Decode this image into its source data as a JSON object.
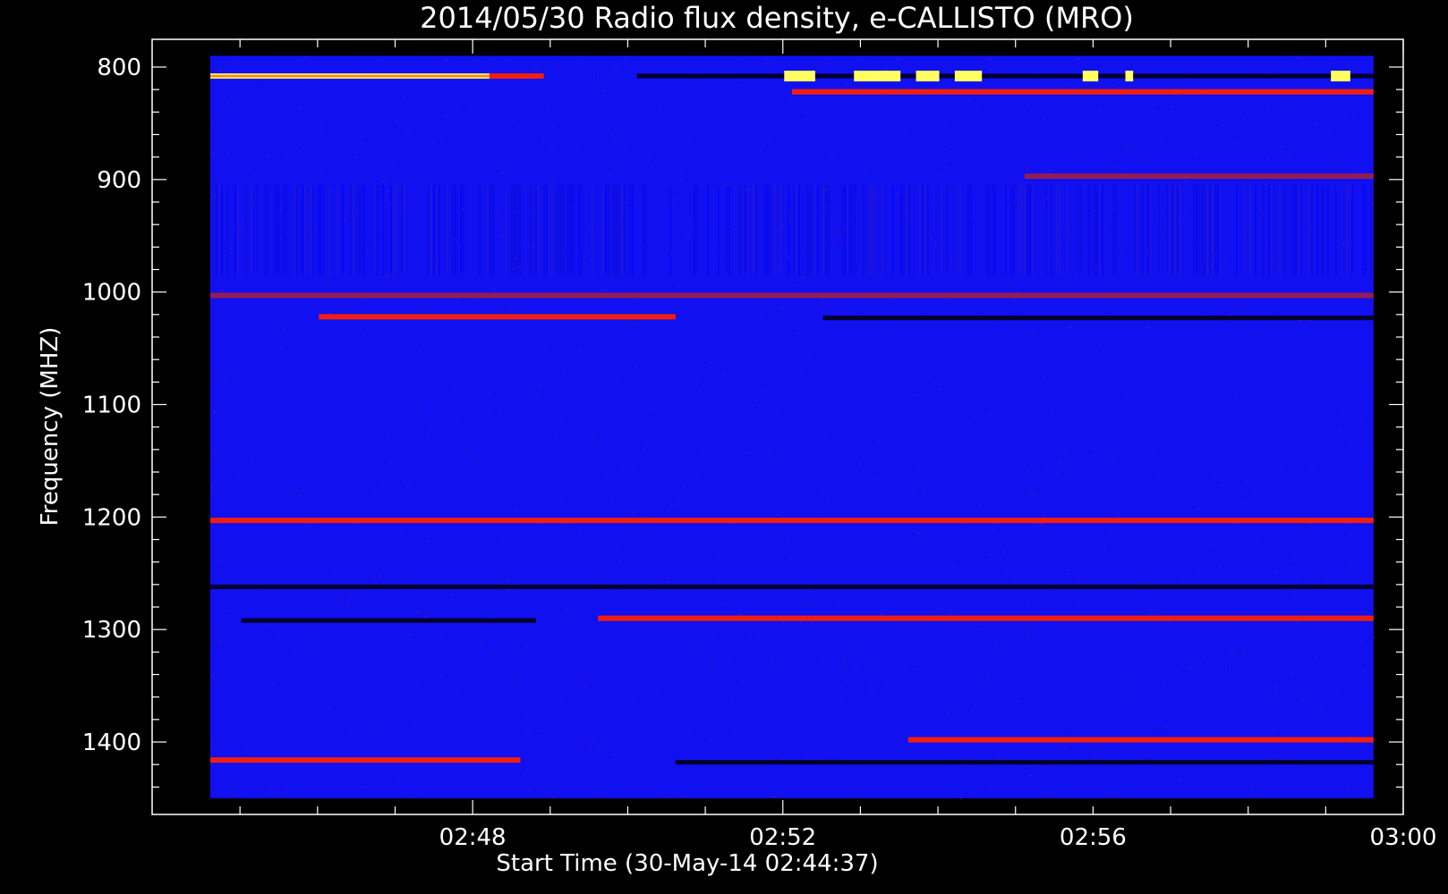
{
  "chart_data": {
    "type": "heatmap",
    "title": "2014/05/30  Radio flux density, e-CALLISTO (MRO)",
    "xlabel": "Start Time (30-May-14 02:44:37)",
    "ylabel": "Frequency (MHZ)",
    "x_ticks": [
      "02:48",
      "02:52",
      "02:56",
      "03:00"
    ],
    "x_tick_minutes": [
      3.383,
      7.383,
      11.383,
      15.383
    ],
    "x_range_minutes": [
      -0.75,
      15.383
    ],
    "data_range_minutes": [
      0,
      15.0
    ],
    "y_ticks": [
      "800",
      "900",
      "1000",
      "1100",
      "1200",
      "1300",
      "1400"
    ],
    "y_tick_values": [
      800,
      900,
      1000,
      1100,
      1200,
      1300,
      1400
    ],
    "ylim": [
      1450,
      790
    ],
    "y_reversed": true,
    "colormap": {
      "background": "#1010f0",
      "low": "#000020",
      "mid": "#c02020",
      "high": "#ff2000",
      "peak": "#ffff60"
    },
    "features": [
      {
        "name": "bright band",
        "freq": 808,
        "t0": 0.0,
        "t1": 3.6,
        "level": "peak"
      },
      {
        "name": "bright band",
        "freq": 808,
        "t0": 3.6,
        "t1": 4.3,
        "level": "high"
      },
      {
        "name": "dark band",
        "freq": 808,
        "t0": 5.5,
        "t1": 15.0,
        "level": "low"
      },
      {
        "name": "bright band",
        "freq": 822,
        "t0": 7.5,
        "t1": 15.0,
        "level": "high"
      },
      {
        "name": "red band",
        "freq": 897,
        "t0": 10.5,
        "t1": 15.0,
        "level": "mid"
      },
      {
        "name": "red band",
        "freq": 1003,
        "t0": 0.0,
        "t1": 15.0,
        "level": "mid"
      },
      {
        "name": "red band",
        "freq": 1022,
        "t0": 1.4,
        "t1": 6.0,
        "level": "high"
      },
      {
        "name": "dark band",
        "freq": 1023,
        "t0": 7.9,
        "t1": 15.0,
        "level": "low"
      },
      {
        "name": "red band",
        "freq": 1203,
        "t0": 0.0,
        "t1": 15.0,
        "level": "high"
      },
      {
        "name": "dark band",
        "freq": 1292,
        "t0": 0.4,
        "t1": 4.2,
        "level": "low"
      },
      {
        "name": "red band",
        "freq": 1290,
        "t0": 5.0,
        "t1": 15.0,
        "level": "high"
      },
      {
        "name": "dark band",
        "freq": 1262,
        "t0": 0.0,
        "t1": 15.0,
        "level": "low"
      },
      {
        "name": "bright band",
        "freq": 1398,
        "t0": 9.0,
        "t1": 15.0,
        "level": "high"
      },
      {
        "name": "bright band",
        "freq": 1416,
        "t0": 0.0,
        "t1": 4.0,
        "level": "high"
      },
      {
        "name": "dark band",
        "freq": 1418,
        "t0": 6.0,
        "t1": 15.0,
        "level": "low"
      }
    ],
    "bursts_808MHz_minutes": [
      [
        7.4,
        7.8
      ],
      [
        8.3,
        8.9
      ],
      [
        9.1,
        9.4
      ],
      [
        9.6,
        9.95
      ],
      [
        11.25,
        11.45
      ],
      [
        11.8,
        11.9
      ],
      [
        14.45,
        14.7
      ]
    ],
    "grid": false,
    "legend": "none"
  }
}
